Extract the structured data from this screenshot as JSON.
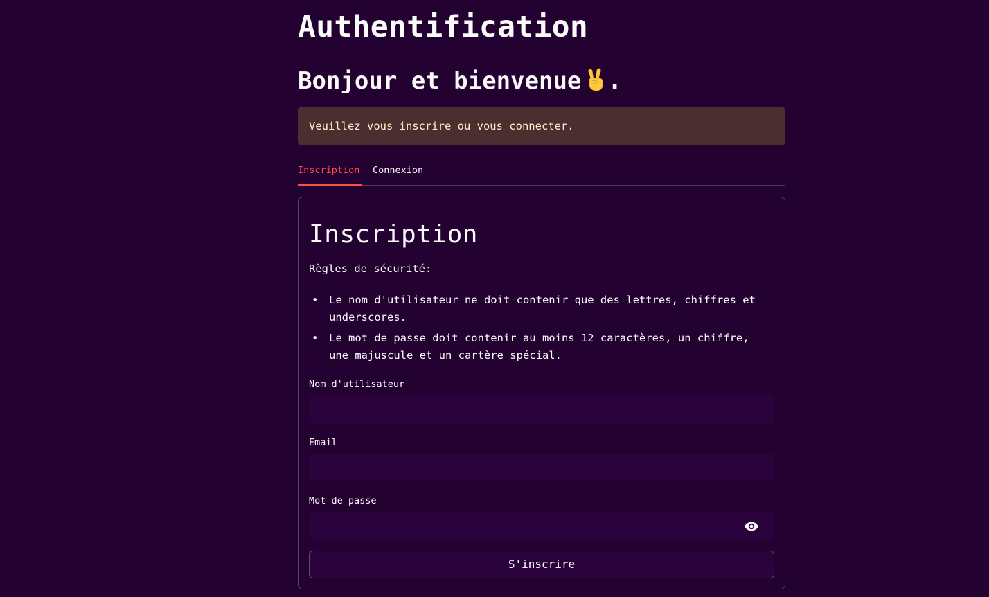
{
  "header": {
    "app_title": "Authentification",
    "greeting_text": "Bonjour et bienvenue",
    "greeting_emoji": "victory-hand-icon",
    "greeting_end": "."
  },
  "alert": {
    "message": "Veuillez vous inscrire ou vous connecter."
  },
  "tabs": [
    {
      "label": "Inscription",
      "active": true
    },
    {
      "label": "Connexion",
      "active": false
    }
  ],
  "form": {
    "title": "Inscription",
    "rules_heading": "Règles de sécurité:",
    "rules": [
      "Le nom d'utilisateur ne doit contenir que des lettres, chiffres et underscores.",
      "Le mot de passe doit contenir au moins 12 caractères, un chiffre, une majuscule et un cartère spécial."
    ],
    "fields": {
      "username_label": "Nom d'utilisateur",
      "username_value": "",
      "email_label": "Email",
      "email_value": "",
      "password_label": "Mot de passe",
      "password_value": "",
      "password_toggle_icon": "eye-icon"
    },
    "submit_label": "S'inscrire"
  },
  "colors": {
    "background": "#230232",
    "input_background": "#2b033c",
    "accent": "#ff4b4b",
    "alert_background": "#4a2e30",
    "alert_text": "#fff1c7",
    "text": "#fafafa"
  }
}
